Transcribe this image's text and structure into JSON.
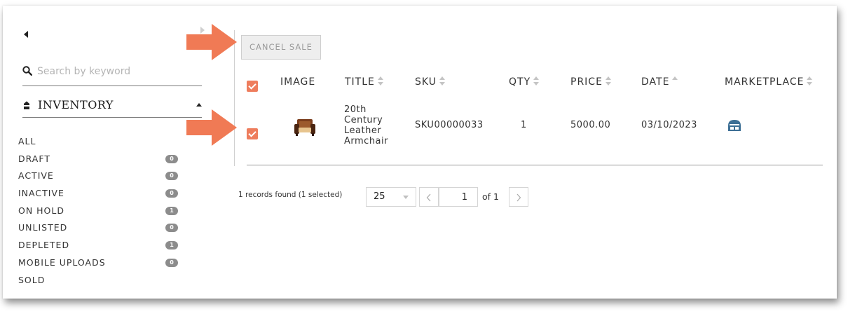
{
  "sidebar": {
    "search_placeholder": "Search by keyword",
    "inventory_title": "INVENTORY",
    "items": [
      {
        "label": "ALL"
      },
      {
        "label": "DRAFT",
        "count": "0"
      },
      {
        "label": "ACTIVE",
        "count": "0"
      },
      {
        "label": "INACTIVE",
        "count": "0"
      },
      {
        "label": "ON HOLD",
        "count": "1"
      },
      {
        "label": "UNLISTED",
        "count": "0"
      },
      {
        "label": "DEPLETED",
        "count": "1"
      },
      {
        "label": "MOBILE UPLOADS",
        "count": "0"
      },
      {
        "label": "SOLD"
      }
    ]
  },
  "toolbar": {
    "cancel_sale_label": "CANCEL SALE"
  },
  "table": {
    "headers": {
      "image": "IMAGE",
      "title": "TITLE",
      "sku": "SKU",
      "qty": "QTY",
      "price": "PRICE",
      "date": "DATE",
      "marketplace": "MARKETPLACE"
    },
    "rows": [
      {
        "title_lines": [
          "20th",
          "Century",
          "Leather",
          "Armchair"
        ],
        "sku": "SKU00000033",
        "qty": "1",
        "price": "5000.00",
        "date": "03/10/2023",
        "marketplace_icon": "storefront-icon"
      }
    ]
  },
  "pagination": {
    "records_text": "1 records found (1 selected)",
    "page_size": "25",
    "page": "1",
    "of_text": "of 1"
  },
  "colors": {
    "accent": "#ee7d5d",
    "arrow": "#f07a55",
    "marketplace_icon": "#3d6f95",
    "badge": "#8c8c8c"
  }
}
